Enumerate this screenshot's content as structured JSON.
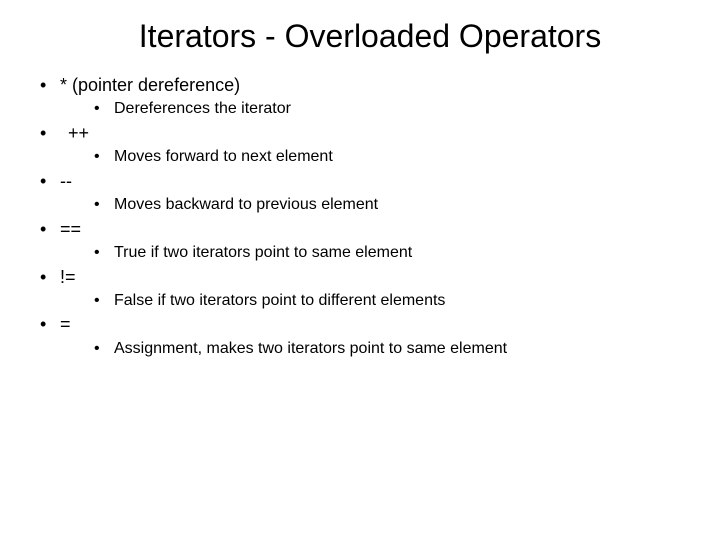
{
  "title": "Iterators - Overloaded Operators",
  "items": [
    {
      "op": "* (pointer dereference)",
      "desc": "Dereferences the iterator",
      "indent": false
    },
    {
      "op": "++",
      "desc": "Moves forward to next element",
      "indent": true
    },
    {
      "op": "--",
      "desc": "Moves backward to previous element",
      "indent": false
    },
    {
      "op": "==",
      "desc": "True if two iterators point to same element",
      "indent": false
    },
    {
      "op": "!=",
      "desc": "False if two iterators point to different elements",
      "indent": false
    },
    {
      "op": "=",
      "desc": "Assignment, makes two iterators point to same element",
      "indent": false
    }
  ]
}
